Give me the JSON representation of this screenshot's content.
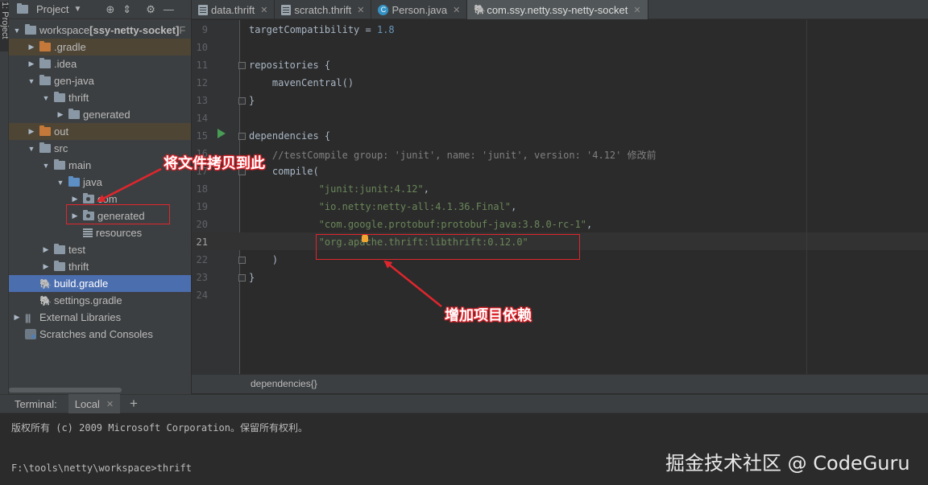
{
  "side_strip": {
    "label": "1: Project"
  },
  "project_panel": {
    "title": "Project",
    "header_icons": [
      "target-icon",
      "collapse-icon",
      "gear-icon",
      "minimize-icon"
    ],
    "tree": [
      {
        "label": "workspace",
        "suffix": "[ssy-netty-socket]",
        "extra": "F",
        "expanded": true,
        "icon": "folder-grey"
      },
      {
        "label": ".gradle",
        "expanded": false,
        "icon": "folder-orange",
        "excluded": true
      },
      {
        "label": ".idea",
        "expanded": false,
        "icon": "folder-grey"
      },
      {
        "label": "gen-java",
        "expanded": true,
        "icon": "folder-grey"
      },
      {
        "label": "thrift",
        "expanded": true,
        "icon": "folder-grey"
      },
      {
        "label": "generated",
        "expanded": false,
        "icon": "folder-grey"
      },
      {
        "label": "out",
        "expanded": false,
        "icon": "folder-orange",
        "excluded": true
      },
      {
        "label": "src",
        "expanded": true,
        "icon": "folder-grey"
      },
      {
        "label": "main",
        "expanded": true,
        "icon": "folder-grey"
      },
      {
        "label": "java",
        "expanded": true,
        "icon": "folder-blue"
      },
      {
        "label": "com",
        "expanded": false,
        "icon": "package"
      },
      {
        "label": "generated",
        "expanded": false,
        "icon": "package"
      },
      {
        "label": "resources",
        "icon": "resources"
      },
      {
        "label": "test",
        "expanded": false,
        "icon": "folder-grey"
      },
      {
        "label": "thrift",
        "expanded": false,
        "icon": "folder-grey"
      },
      {
        "label": "build.gradle",
        "icon": "gradle",
        "selected": true
      },
      {
        "label": "settings.gradle",
        "icon": "gradle"
      },
      {
        "label": "External Libraries",
        "expanded": false,
        "icon": "libraries"
      },
      {
        "label": "Scratches and Consoles",
        "icon": "scratch"
      }
    ]
  },
  "tabs": [
    {
      "label": "data.thrift",
      "icon": "document-icon",
      "active": false
    },
    {
      "label": "scratch.thrift",
      "icon": "document-icon",
      "active": false
    },
    {
      "label": "Person.java",
      "icon": "class-icon",
      "active": false
    },
    {
      "label": "com.ssy.netty.ssy-netty-socket",
      "icon": "gradle-icon",
      "active": true
    }
  ],
  "editor": {
    "current_line": 21,
    "lines": [
      {
        "n": "9",
        "parts": [
          [
            "",
            "targetCompatibility = "
          ],
          [
            "num",
            "1.8"
          ]
        ]
      },
      {
        "n": "10",
        "parts": []
      },
      {
        "n": "11",
        "parts": [
          [
            "",
            "repositories {"
          ]
        ]
      },
      {
        "n": "12",
        "parts": [
          [
            "",
            "    mavenCentral()"
          ]
        ]
      },
      {
        "n": "13",
        "parts": [
          [
            "",
            "}"
          ]
        ]
      },
      {
        "n": "14",
        "parts": []
      },
      {
        "n": "15",
        "parts": [
          [
            "",
            "dependencies {"
          ]
        ]
      },
      {
        "n": "16",
        "parts": [
          [
            "cmt",
            "    //testCompile group: 'junit', name: 'junit', version: '4.12' 修改前"
          ]
        ]
      },
      {
        "n": "17",
        "parts": [
          [
            "",
            "    compile("
          ]
        ]
      },
      {
        "n": "18",
        "parts": [
          [
            "str",
            "            \"junit:junit:4.12\""
          ],
          [
            "",
            ","
          ]
        ]
      },
      {
        "n": "19",
        "parts": [
          [
            "str",
            "            \"io.netty:netty-all:4.1.36.Final\""
          ],
          [
            "",
            ","
          ]
        ]
      },
      {
        "n": "20",
        "parts": [
          [
            "str",
            "            \"com.google.protobuf:protobuf-java:3.8.0-rc-1\""
          ],
          [
            "",
            ","
          ]
        ]
      },
      {
        "n": "21",
        "parts": [
          [
            "str",
            "            \"org.apache.thrift:libthrift:0.12.0\""
          ]
        ]
      },
      {
        "n": "22",
        "parts": [
          [
            "",
            "    )"
          ]
        ]
      },
      {
        "n": "23",
        "parts": [
          [
            "",
            "}"
          ]
        ]
      },
      {
        "n": "24",
        "parts": []
      }
    ]
  },
  "breadcrumb": {
    "text": "dependencies{}"
  },
  "terminal": {
    "title": "Terminal:",
    "tab": "Local",
    "lines": [
      "版权所有 (c) 2009 Microsoft Corporation。保留所有权利。",
      "",
      "F:\\tools\\netty\\workspace>thrift"
    ]
  },
  "annotations": {
    "copy_here": "将文件拷贝到此",
    "add_dependency": "增加项目依赖"
  },
  "watermark": "掘金技术社区 @ CodeGuru"
}
